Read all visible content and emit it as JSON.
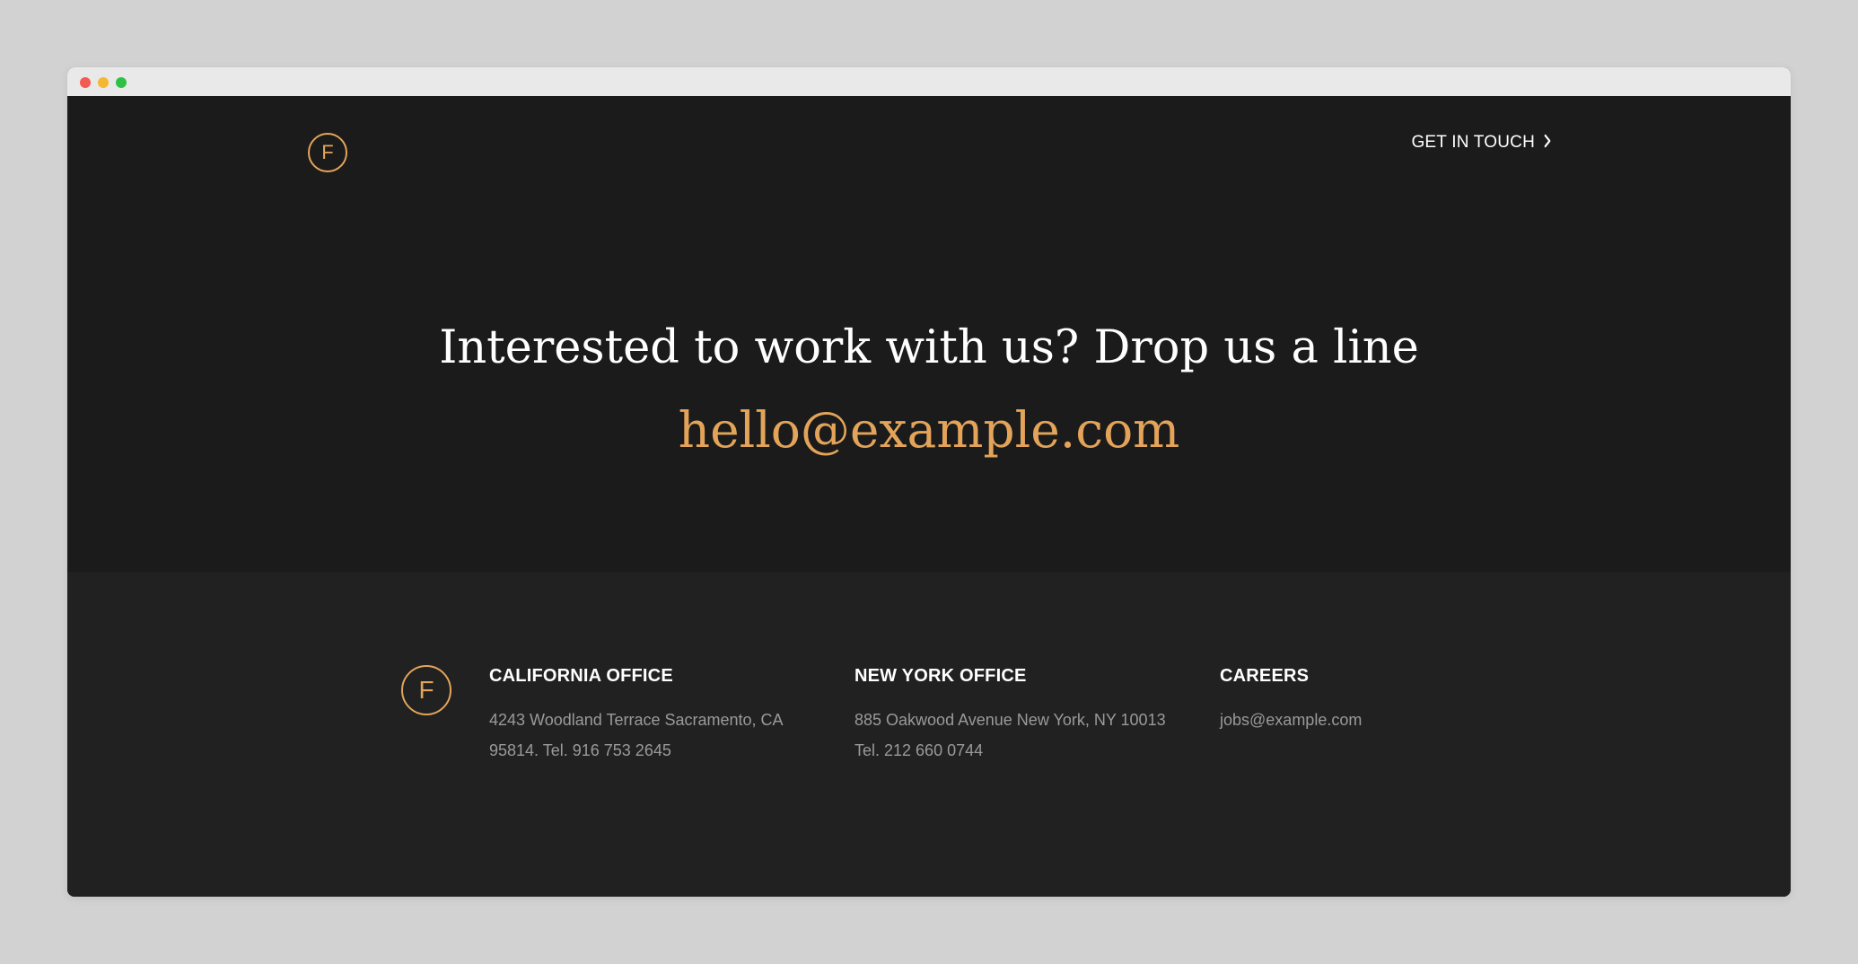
{
  "header": {
    "logo_letter": "F",
    "cta_label": "GET IN TOUCH",
    "cta_icon": "chevron-right-icon"
  },
  "hero": {
    "headline": "Interested to work with us? Drop us a line",
    "email": "hello@example.com"
  },
  "footer": {
    "logo_letter": "F",
    "columns": [
      {
        "title": "CALIFORNIA OFFICE",
        "line1": "4243 Woodland Terrace Sacramento, CA",
        "line2": "95814. Tel. 916 753 2645"
      },
      {
        "title": "NEW YORK OFFICE",
        "line1": "885 Oakwood Avenue New York, NY 10013",
        "line2": "Tel. 212 660 0744"
      },
      {
        "title": "CAREERS",
        "line1": "jobs@example.com"
      }
    ]
  },
  "colors": {
    "accent": "#e3a45a",
    "hero_bg": "#1b1b1b",
    "footer_bg": "#212121",
    "text_primary": "#ffffff",
    "text_muted": "#9a9a9a"
  }
}
